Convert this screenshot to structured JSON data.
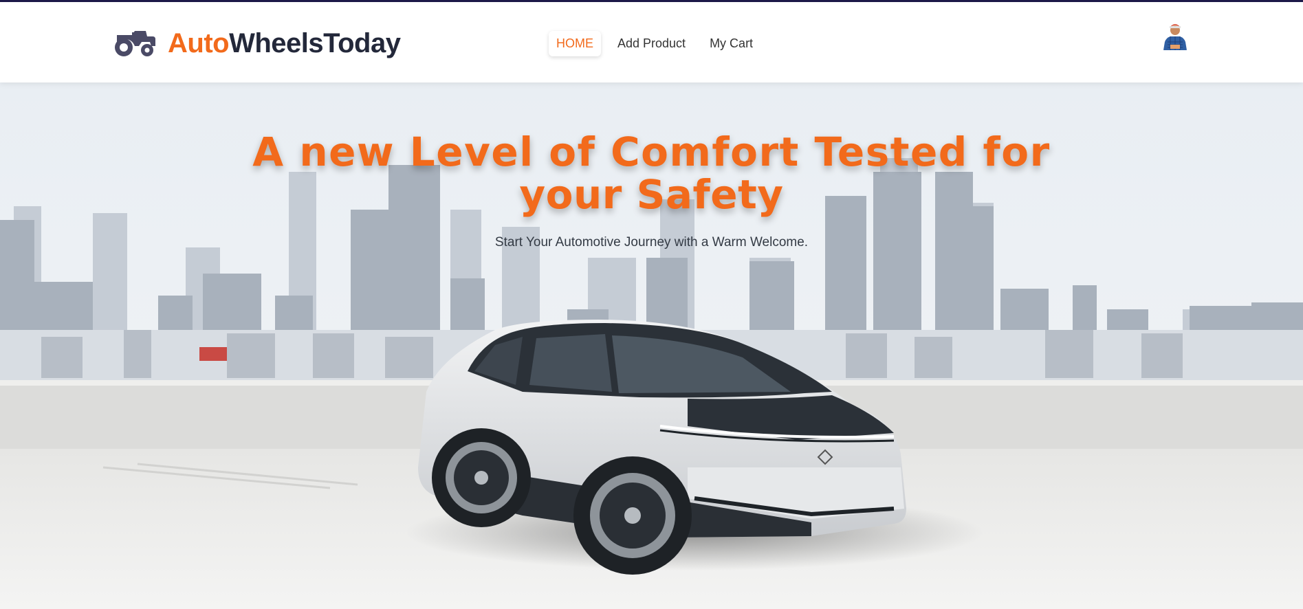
{
  "brand": {
    "icon": "tractor-icon",
    "name_part1": "Auto",
    "name_part2": "WheelsToday"
  },
  "nav": {
    "items": [
      {
        "label": "HOME",
        "active": true
      },
      {
        "label": "Add Product",
        "active": false
      },
      {
        "label": "My Cart",
        "active": false
      }
    ]
  },
  "user": {
    "avatar_icon": "user-avatar-icon"
  },
  "hero": {
    "title_line1": "A new Level of Comfort Tested for",
    "title_line2": "your Safety",
    "subtitle": "Start Your Automotive Journey with a Warm Welcome.",
    "image": "white electric SUV on rooftop parking with city skyline"
  },
  "colors": {
    "accent": "#f26a1b",
    "brand_dark": "#23283a",
    "topline": "#1e1a4a"
  }
}
